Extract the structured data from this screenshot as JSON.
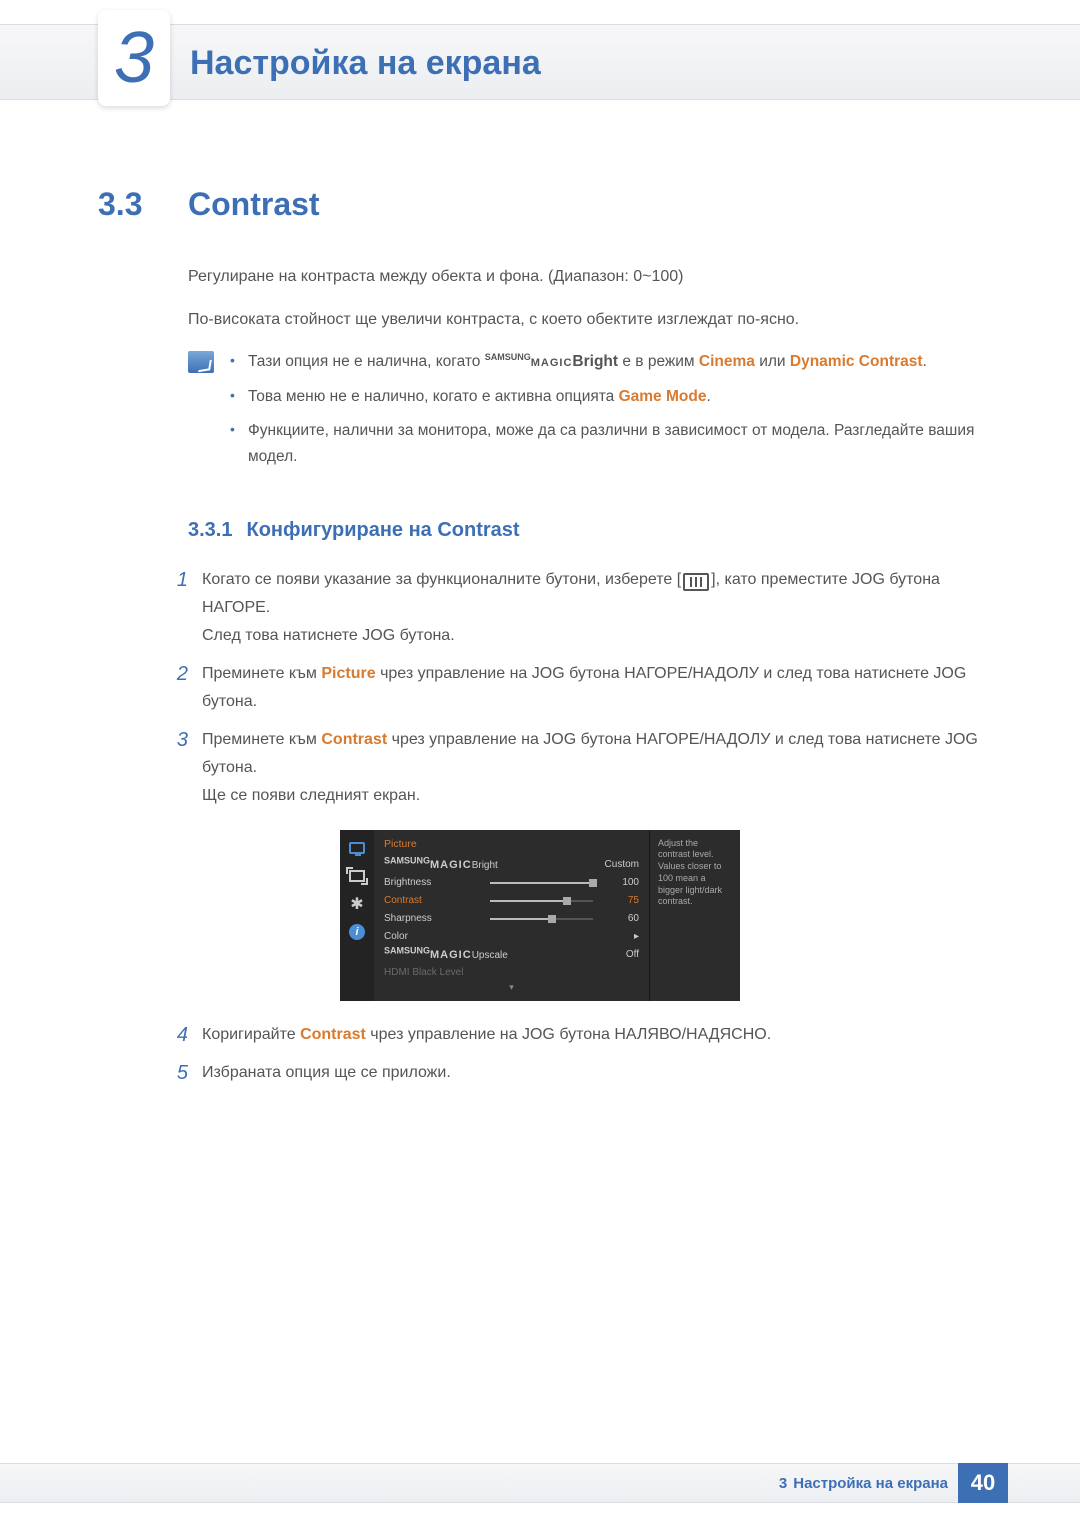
{
  "chapter": {
    "number": "3",
    "title": "Настройка на екрана"
  },
  "section": {
    "number": "3.3",
    "title": "Contrast",
    "intro1": "Регулиране на контраста между обекта и фона. (Диапазон: 0~100)",
    "intro2": "По-високата стойност ще увеличи контраста, с което обектите изглеждат по-ясно."
  },
  "notes": {
    "n1_a": "Тази опция не е налична, когато ",
    "n1_sup": "SAMSUNG",
    "n1_sub": "MAGIC",
    "n1_b": "Bright",
    "n1_c": " е в режим ",
    "n1_cinema": "Cinema",
    "n1_or": " или ",
    "n1_dc": "Dynamic Contrast",
    "n1_dot": ".",
    "n2_a": "Това меню не е налично, когато е активна опцията ",
    "n2_gm": "Game Mode",
    "n2_dot": ".",
    "n3": "Функциите, налични за монитора, може да са различни в зависимост от модела. Разгледайте вашия модел."
  },
  "subsection": {
    "number": "3.3.1",
    "title": "Конфигуриране на Contrast"
  },
  "steps": {
    "s1n": "1",
    "s1a": "Когато се появи указание за функционалните бутони, изберете [",
    "s1b": "], като преместите JOG бутона НАГОРЕ.",
    "s1c": "След това натиснете JOG бутона.",
    "s2n": "2",
    "s2a": "Преминете към ",
    "s2_pic": "Picture",
    "s2b": " чрез управление на JOG бутона НАГОРЕ/НАДОЛУ и след това натиснете JOG бутона.",
    "s3n": "3",
    "s3a": "Преминете към ",
    "s3_con": "Contrast",
    "s3b": " чрез управление на JOG бутона НАГОРЕ/НАДОЛУ и след това натиснете JOG бутона.",
    "s3c": "Ще се появи следният екран.",
    "s4n": "4",
    "s4a": "Коригирайте ",
    "s4_con": "Contrast",
    "s4b": " чрез управление на JOG бутона НАЛЯВО/НАДЯСНО.",
    "s5n": "5",
    "s5a": "Избраната опция ще се приложи."
  },
  "osd": {
    "title": "Picture",
    "magic_sup": "SAMSUNG",
    "magic_sub": "MAGIC",
    "bright_label": "Bright",
    "bright_val": "Custom",
    "brightness_label": "Brightness",
    "brightness_val": "100",
    "contrast_label": "Contrast",
    "contrast_val": "75",
    "sharpness_label": "Sharpness",
    "sharpness_val": "60",
    "color_label": "Color",
    "color_arrow": "▸",
    "upscale_label": "Upscale",
    "upscale_val": "Off",
    "hdmi_label": "HDMI Black Level",
    "down_arrow": "▾",
    "help": "Adjust the contrast level. Values closer to 100 mean a bigger light/dark contrast."
  },
  "footer": {
    "chapter_ref": "3",
    "title": "Настройка на екрана",
    "page": "40"
  }
}
